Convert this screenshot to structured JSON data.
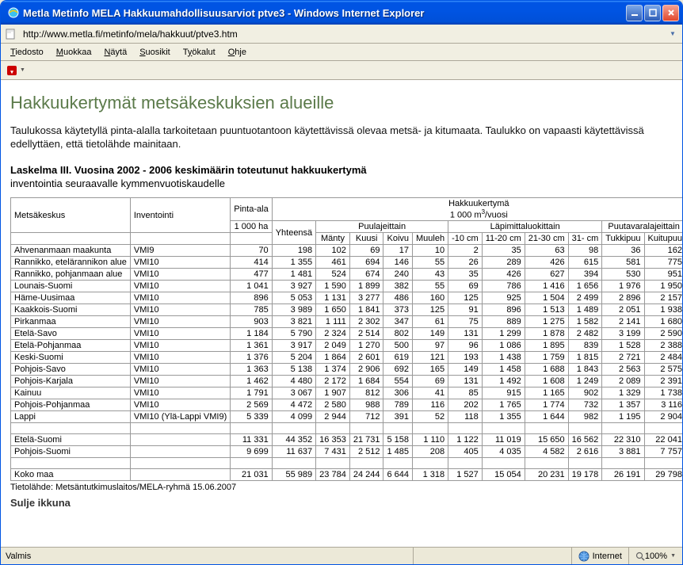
{
  "window": {
    "title": "Metla Metinfo MELA Hakkuumahdollisuusarviot ptve3 - Windows Internet Explorer"
  },
  "address": {
    "url": "http://www.metla.fi/metinfo/mela/hakkuut/ptve3.htm"
  },
  "menu": {
    "tiedosto": "Tiedosto",
    "muokkaa": "Muokkaa",
    "nayta": "Näytä",
    "suosikit": "Suosikit",
    "tyokalut": "Työkalut",
    "ohje": "Ohje"
  },
  "page": {
    "h1": "Hakkuukertymät metsäkeskuksien alueille",
    "intro": "Taulukossa käytetyllä pinta-alalla tarkoitetaan puuntuotantoon käytettävissä olevaa metsä- ja kitumaata. Taulukko on vapaasti käytettävissä edellyttäen, että tietolähde mainitaan.",
    "tbl_title": "Laskelma III. Vuosina 2002 - 2006 keskimäärin toteutunut hakkuukertymä",
    "tbl_sub": "inventointia seuraavalle kymmenvuotiskaudelle",
    "source": "Tietolähde: Metsäntutkimuslaitos/MELA-ryhmä 15.06.2007",
    "cutoff": "Sulje ikkuna"
  },
  "headers": {
    "mk": "Metsäkeskus",
    "inv": "Inventointi",
    "pa": "Pinta-ala",
    "pa_unit": "1 000 ha",
    "hk": "Hakkuukertymä",
    "hk_unit_a": "1 000 m",
    "hk_unit_b": "/vuosi",
    "yht": "Yhteensä",
    "puulaj": "Puulajeittain",
    "lapim": "Läpimittaluokittain",
    "puutav": "Puutavaralajeittain",
    "manty": "Mänty",
    "kuusi": "Kuusi",
    "koivu": "Koivu",
    "muuleh": "Muuleh",
    "d10": "-10 cm",
    "d11": "11-20 cm",
    "d21": "21-30 cm",
    "d31": "31- cm",
    "tukki": "Tukkipuu",
    "kuitu": "Kuitupuu"
  },
  "rows": [
    {
      "mk": "Ahvenanmaan maakunta",
      "inv": "VMI9",
      "pa": "70",
      "yht": "198",
      "manty": "102",
      "kuusi": "69",
      "koivu": "17",
      "muu": "10",
      "d10": "2",
      "d11": "35",
      "d21": "63",
      "d31": "98",
      "tuk": "36",
      "kui": "162"
    },
    {
      "mk": "Rannikko, etelärannikon alue",
      "inv": "VMI10",
      "pa": "414",
      "yht": "1 355",
      "manty": "461",
      "kuusi": "694",
      "koivu": "146",
      "muu": "55",
      "d10": "26",
      "d11": "289",
      "d21": "426",
      "d31": "615",
      "tuk": "581",
      "kui": "775"
    },
    {
      "mk": "Rannikko, pohjanmaan alue",
      "inv": "VMI10",
      "pa": "477",
      "yht": "1 481",
      "manty": "524",
      "kuusi": "674",
      "koivu": "240",
      "muu": "43",
      "d10": "35",
      "d11": "426",
      "d21": "627",
      "d31": "394",
      "tuk": "530",
      "kui": "951"
    },
    {
      "mk": "Lounais-Suomi",
      "inv": "VMI10",
      "pa": "1 041",
      "yht": "3 927",
      "manty": "1 590",
      "kuusi": "1 899",
      "koivu": "382",
      "muu": "55",
      "d10": "69",
      "d11": "786",
      "d21": "1 416",
      "d31": "1 656",
      "tuk": "1 976",
      "kui": "1 950"
    },
    {
      "mk": "Häme-Uusimaa",
      "inv": "VMI10",
      "pa": "896",
      "yht": "5 053",
      "manty": "1 131",
      "kuusi": "3 277",
      "koivu": "486",
      "muu": "160",
      "d10": "125",
      "d11": "925",
      "d21": "1 504",
      "d31": "2 499",
      "tuk": "2 896",
      "kui": "2 157"
    },
    {
      "mk": "Kaakkois-Suomi",
      "inv": "VMI10",
      "pa": "785",
      "yht": "3 989",
      "manty": "1 650",
      "kuusi": "1 841",
      "koivu": "373",
      "muu": "125",
      "d10": "91",
      "d11": "896",
      "d21": "1 513",
      "d31": "1 489",
      "tuk": "2 051",
      "kui": "1 938"
    },
    {
      "mk": "Pirkanmaa",
      "inv": "VMI10",
      "pa": "903",
      "yht": "3 821",
      "manty": "1 111",
      "kuusi": "2 302",
      "koivu": "347",
      "muu": "61",
      "d10": "75",
      "d11": "889",
      "d21": "1 275",
      "d31": "1 582",
      "tuk": "2 141",
      "kui": "1 680"
    },
    {
      "mk": "Etelä-Savo",
      "inv": "VMI10",
      "pa": "1 184",
      "yht": "5 790",
      "manty": "2 324",
      "kuusi": "2 514",
      "koivu": "802",
      "muu": "149",
      "d10": "131",
      "d11": "1 299",
      "d21": "1 878",
      "d31": "2 482",
      "tuk": "3 199",
      "kui": "2 590"
    },
    {
      "mk": "Etelä-Pohjanmaa",
      "inv": "VMI10",
      "pa": "1 361",
      "yht": "3 917",
      "manty": "2 049",
      "kuusi": "1 270",
      "koivu": "500",
      "muu": "97",
      "d10": "96",
      "d11": "1 086",
      "d21": "1 895",
      "d31": "839",
      "tuk": "1 528",
      "kui": "2 388"
    },
    {
      "mk": "Keski-Suomi",
      "inv": "VMI10",
      "pa": "1 376",
      "yht": "5 204",
      "manty": "1 864",
      "kuusi": "2 601",
      "koivu": "619",
      "muu": "121",
      "d10": "193",
      "d11": "1 438",
      "d21": "1 759",
      "d31": "1 815",
      "tuk": "2 721",
      "kui": "2 484"
    },
    {
      "mk": "Pohjois-Savo",
      "inv": "VMI10",
      "pa": "1 363",
      "yht": "5 138",
      "manty": "1 374",
      "kuusi": "2 906",
      "koivu": "692",
      "muu": "165",
      "d10": "149",
      "d11": "1 458",
      "d21": "1 688",
      "d31": "1 843",
      "tuk": "2 563",
      "kui": "2 575"
    },
    {
      "mk": "Pohjois-Karjala",
      "inv": "VMI10",
      "pa": "1 462",
      "yht": "4 480",
      "manty": "2 172",
      "kuusi": "1 684",
      "koivu": "554",
      "muu": "69",
      "d10": "131",
      "d11": "1 492",
      "d21": "1 608",
      "d31": "1 249",
      "tuk": "2 089",
      "kui": "2 391"
    },
    {
      "mk": "Kainuu",
      "inv": "VMI10",
      "pa": "1 791",
      "yht": "3 067",
      "manty": "1 907",
      "kuusi": "812",
      "koivu": "306",
      "muu": "41",
      "d10": "85",
      "d11": "915",
      "d21": "1 165",
      "d31": "902",
      "tuk": "1 329",
      "kui": "1 738"
    },
    {
      "mk": "Pohjois-Pohjanmaa",
      "inv": "VMI10",
      "pa": "2 569",
      "yht": "4 472",
      "manty": "2 580",
      "kuusi": "988",
      "koivu": "789",
      "muu": "116",
      "d10": "202",
      "d11": "1 765",
      "d21": "1 774",
      "d31": "732",
      "tuk": "1 357",
      "kui": "3 116"
    },
    {
      "mk": "Lappi",
      "inv": "VMI10 (Ylä-Lappi VMI9)",
      "pa": "5 339",
      "yht": "4 099",
      "manty": "2 944",
      "kuusi": "712",
      "koivu": "391",
      "muu": "52",
      "d10": "118",
      "d11": "1 355",
      "d21": "1 644",
      "d31": "982",
      "tuk": "1 195",
      "kui": "2 904"
    }
  ],
  "sums": [
    {
      "mk": "Etelä-Suomi",
      "inv": "",
      "pa": "11 331",
      "yht": "44 352",
      "manty": "16 353",
      "kuusi": "21 731",
      "koivu": "5 158",
      "muu": "1 110",
      "d10": "1 122",
      "d11": "11 019",
      "d21": "15 650",
      "d31": "16 562",
      "tuk": "22 310",
      "kui": "22 041"
    },
    {
      "mk": "Pohjois-Suomi",
      "inv": "",
      "pa": "9 699",
      "yht": "11 637",
      "manty": "7 431",
      "kuusi": "2 512",
      "koivu": "1 485",
      "muu": "208",
      "d10": "405",
      "d11": "4 035",
      "d21": "4 582",
      "d31": "2 616",
      "tuk": "3 881",
      "kui": "7 757"
    }
  ],
  "total": {
    "mk": "Koko maa",
    "inv": "",
    "pa": "21 031",
    "yht": "55 989",
    "manty": "23 784",
    "kuusi": "24 244",
    "koivu": "6 644",
    "muu": "1 318",
    "d10": "1 527",
    "d11": "15 054",
    "d21": "20 231",
    "d31": "19 178",
    "tuk": "26 191",
    "kui": "29 798"
  },
  "status": {
    "ready": "Valmis",
    "zone": "Internet",
    "zoom": "100%"
  }
}
